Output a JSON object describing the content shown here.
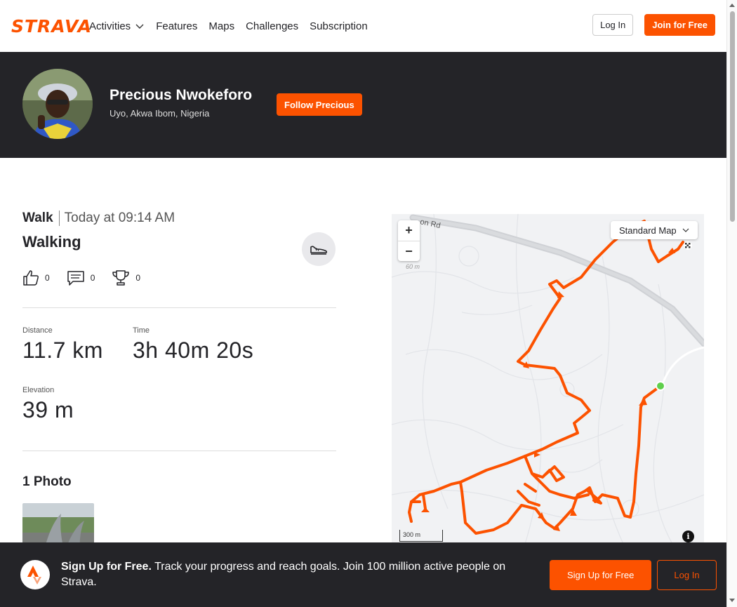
{
  "nav": {
    "logo": "STRAVA",
    "links": [
      "Activities",
      "Features",
      "Maps",
      "Challenges",
      "Subscription"
    ],
    "login": "Log In",
    "join": "Join for Free"
  },
  "profile": {
    "name": "Precious Nwokeforo",
    "location": "Uyo, Akwa Ibom, Nigeria",
    "follow": "Follow Precious"
  },
  "activity": {
    "type": "Walk",
    "date": "Today at 09:14 AM",
    "title": "Walking",
    "kudos": "0",
    "comments": "0",
    "achievements": "0",
    "stats": {
      "distance_label": "Distance",
      "distance": "11.7 km",
      "time_label": "Time",
      "time": "3h 40m 20s",
      "elevation_label": "Elevation",
      "elevation": "39 m"
    },
    "photos_title": "1 Photo"
  },
  "map": {
    "style": "Standard Map",
    "zoom_in": "+",
    "zoom_out": "−",
    "scale": "300 m",
    "road_label": "on Rd",
    "elev_label": "60 m",
    "info": "i",
    "route_color": "#fc5200",
    "start_color": "#5fcf4c"
  },
  "banner": {
    "headline": "Sign Up for Free.",
    "text": "Track your progress and reach goals. Join 100 million active people on Strava.",
    "signup": "Sign Up for Free",
    "login": "Log In"
  }
}
